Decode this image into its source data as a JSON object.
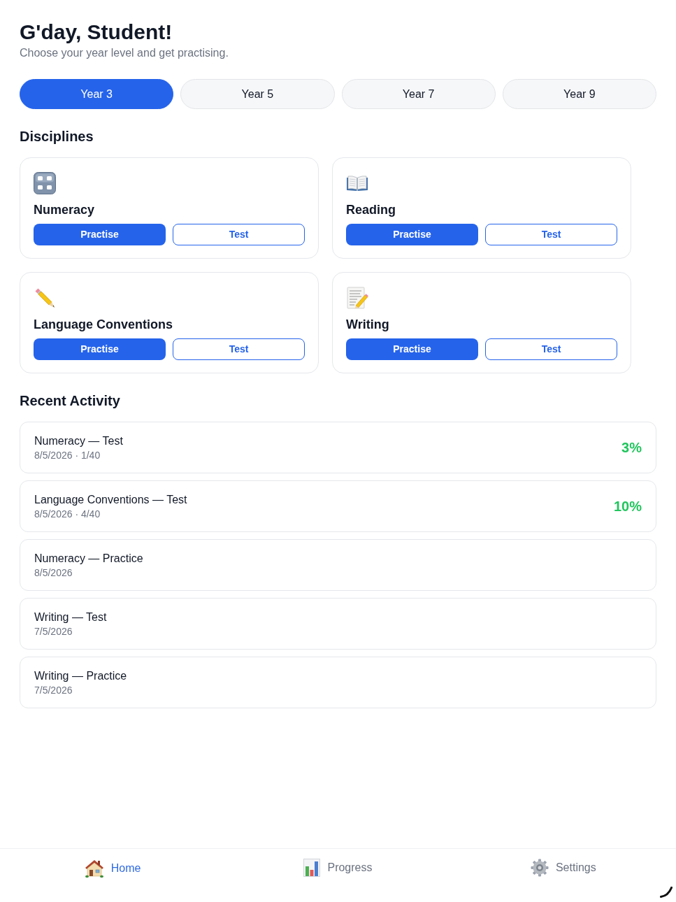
{
  "header": {
    "title": "G'day, Student!",
    "subtitle": "Choose your year level and get practising."
  },
  "year_tabs": [
    {
      "label": "Year 3",
      "selected": true
    },
    {
      "label": "Year 5",
      "selected": false
    },
    {
      "label": "Year 7",
      "selected": false
    },
    {
      "label": "Year 9",
      "selected": false
    }
  ],
  "disciplines": {
    "heading": "Disciplines",
    "items": [
      {
        "kind": "numeracy",
        "name": "Numeracy",
        "practise": "Practise",
        "test": "Test"
      },
      {
        "kind": "reading",
        "name": "Reading",
        "practise": "Practise",
        "test": "Test"
      },
      {
        "kind": "language",
        "name": "Language Conventions",
        "practise": "Practise",
        "test": "Test"
      },
      {
        "kind": "writing",
        "name": "Writing",
        "practise": "Practise",
        "test": "Test"
      }
    ]
  },
  "recent_activity": {
    "heading": "Recent Activity",
    "items": [
      {
        "title": "Numeracy — Test",
        "meta": "8/5/2026 · 1/40",
        "score": "3%"
      },
      {
        "title": "Language Conventions — Test",
        "meta": "8/5/2026 · 4/40",
        "score": "10%"
      },
      {
        "title": "Numeracy — Practice",
        "meta": "8/5/2026"
      },
      {
        "title": "Writing — Test",
        "meta": "7/5/2026"
      },
      {
        "title": "Writing — Practice",
        "meta": "7/5/2026"
      }
    ]
  },
  "bottom_nav": [
    {
      "kind": "home",
      "label": "Home",
      "selected": true
    },
    {
      "kind": "progress",
      "label": "Progress",
      "selected": false
    },
    {
      "kind": "settings",
      "label": "Settings",
      "selected": false
    }
  ]
}
